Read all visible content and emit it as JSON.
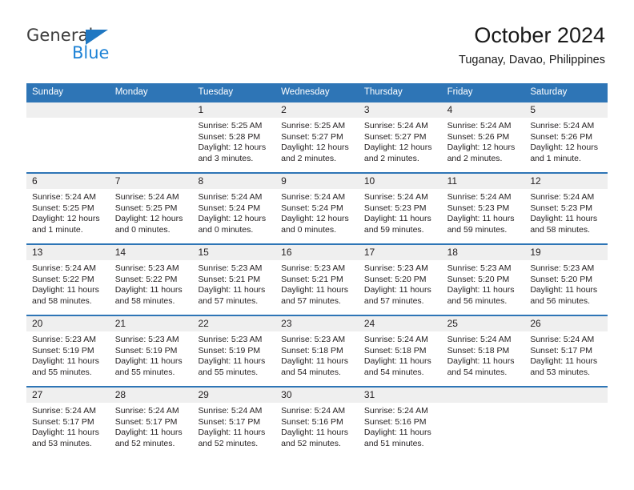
{
  "brand": {
    "name_part1": "General",
    "name_part2": "Blue",
    "triangle_color": "#1f77c2",
    "blue_color": "#1f83d6"
  },
  "header": {
    "title": "October 2024",
    "subtitle": "Tuganay, Davao, Philippines"
  },
  "theme": {
    "header_blue": "#2e75b6",
    "day_band_gray": "#efefef",
    "text": "#231f20"
  },
  "weekday_headers": [
    "Sunday",
    "Monday",
    "Tuesday",
    "Wednesday",
    "Thursday",
    "Friday",
    "Saturday"
  ],
  "weeks": [
    [
      {
        "day": "",
        "sunrise": "",
        "sunset": "",
        "daylight1": "",
        "daylight2": ""
      },
      {
        "day": "",
        "sunrise": "",
        "sunset": "",
        "daylight1": "",
        "daylight2": ""
      },
      {
        "day": "1",
        "sunrise": "Sunrise: 5:25 AM",
        "sunset": "Sunset: 5:28 PM",
        "daylight1": "Daylight: 12 hours",
        "daylight2": "and 3 minutes."
      },
      {
        "day": "2",
        "sunrise": "Sunrise: 5:25 AM",
        "sunset": "Sunset: 5:27 PM",
        "daylight1": "Daylight: 12 hours",
        "daylight2": "and 2 minutes."
      },
      {
        "day": "3",
        "sunrise": "Sunrise: 5:24 AM",
        "sunset": "Sunset: 5:27 PM",
        "daylight1": "Daylight: 12 hours",
        "daylight2": "and 2 minutes."
      },
      {
        "day": "4",
        "sunrise": "Sunrise: 5:24 AM",
        "sunset": "Sunset: 5:26 PM",
        "daylight1": "Daylight: 12 hours",
        "daylight2": "and 2 minutes."
      },
      {
        "day": "5",
        "sunrise": "Sunrise: 5:24 AM",
        "sunset": "Sunset: 5:26 PM",
        "daylight1": "Daylight: 12 hours",
        "daylight2": "and 1 minute."
      }
    ],
    [
      {
        "day": "6",
        "sunrise": "Sunrise: 5:24 AM",
        "sunset": "Sunset: 5:25 PM",
        "daylight1": "Daylight: 12 hours",
        "daylight2": "and 1 minute."
      },
      {
        "day": "7",
        "sunrise": "Sunrise: 5:24 AM",
        "sunset": "Sunset: 5:25 PM",
        "daylight1": "Daylight: 12 hours",
        "daylight2": "and 0 minutes."
      },
      {
        "day": "8",
        "sunrise": "Sunrise: 5:24 AM",
        "sunset": "Sunset: 5:24 PM",
        "daylight1": "Daylight: 12 hours",
        "daylight2": "and 0 minutes."
      },
      {
        "day": "9",
        "sunrise": "Sunrise: 5:24 AM",
        "sunset": "Sunset: 5:24 PM",
        "daylight1": "Daylight: 12 hours",
        "daylight2": "and 0 minutes."
      },
      {
        "day": "10",
        "sunrise": "Sunrise: 5:24 AM",
        "sunset": "Sunset: 5:23 PM",
        "daylight1": "Daylight: 11 hours",
        "daylight2": "and 59 minutes."
      },
      {
        "day": "11",
        "sunrise": "Sunrise: 5:24 AM",
        "sunset": "Sunset: 5:23 PM",
        "daylight1": "Daylight: 11 hours",
        "daylight2": "and 59 minutes."
      },
      {
        "day": "12",
        "sunrise": "Sunrise: 5:24 AM",
        "sunset": "Sunset: 5:23 PM",
        "daylight1": "Daylight: 11 hours",
        "daylight2": "and 58 minutes."
      }
    ],
    [
      {
        "day": "13",
        "sunrise": "Sunrise: 5:24 AM",
        "sunset": "Sunset: 5:22 PM",
        "daylight1": "Daylight: 11 hours",
        "daylight2": "and 58 minutes."
      },
      {
        "day": "14",
        "sunrise": "Sunrise: 5:23 AM",
        "sunset": "Sunset: 5:22 PM",
        "daylight1": "Daylight: 11 hours",
        "daylight2": "and 58 minutes."
      },
      {
        "day": "15",
        "sunrise": "Sunrise: 5:23 AM",
        "sunset": "Sunset: 5:21 PM",
        "daylight1": "Daylight: 11 hours",
        "daylight2": "and 57 minutes."
      },
      {
        "day": "16",
        "sunrise": "Sunrise: 5:23 AM",
        "sunset": "Sunset: 5:21 PM",
        "daylight1": "Daylight: 11 hours",
        "daylight2": "and 57 minutes."
      },
      {
        "day": "17",
        "sunrise": "Sunrise: 5:23 AM",
        "sunset": "Sunset: 5:20 PM",
        "daylight1": "Daylight: 11 hours",
        "daylight2": "and 57 minutes."
      },
      {
        "day": "18",
        "sunrise": "Sunrise: 5:23 AM",
        "sunset": "Sunset: 5:20 PM",
        "daylight1": "Daylight: 11 hours",
        "daylight2": "and 56 minutes."
      },
      {
        "day": "19",
        "sunrise": "Sunrise: 5:23 AM",
        "sunset": "Sunset: 5:20 PM",
        "daylight1": "Daylight: 11 hours",
        "daylight2": "and 56 minutes."
      }
    ],
    [
      {
        "day": "20",
        "sunrise": "Sunrise: 5:23 AM",
        "sunset": "Sunset: 5:19 PM",
        "daylight1": "Daylight: 11 hours",
        "daylight2": "and 55 minutes."
      },
      {
        "day": "21",
        "sunrise": "Sunrise: 5:23 AM",
        "sunset": "Sunset: 5:19 PM",
        "daylight1": "Daylight: 11 hours",
        "daylight2": "and 55 minutes."
      },
      {
        "day": "22",
        "sunrise": "Sunrise: 5:23 AM",
        "sunset": "Sunset: 5:19 PM",
        "daylight1": "Daylight: 11 hours",
        "daylight2": "and 55 minutes."
      },
      {
        "day": "23",
        "sunrise": "Sunrise: 5:23 AM",
        "sunset": "Sunset: 5:18 PM",
        "daylight1": "Daylight: 11 hours",
        "daylight2": "and 54 minutes."
      },
      {
        "day": "24",
        "sunrise": "Sunrise: 5:24 AM",
        "sunset": "Sunset: 5:18 PM",
        "daylight1": "Daylight: 11 hours",
        "daylight2": "and 54 minutes."
      },
      {
        "day": "25",
        "sunrise": "Sunrise: 5:24 AM",
        "sunset": "Sunset: 5:18 PM",
        "daylight1": "Daylight: 11 hours",
        "daylight2": "and 54 minutes."
      },
      {
        "day": "26",
        "sunrise": "Sunrise: 5:24 AM",
        "sunset": "Sunset: 5:17 PM",
        "daylight1": "Daylight: 11 hours",
        "daylight2": "and 53 minutes."
      }
    ],
    [
      {
        "day": "27",
        "sunrise": "Sunrise: 5:24 AM",
        "sunset": "Sunset: 5:17 PM",
        "daylight1": "Daylight: 11 hours",
        "daylight2": "and 53 minutes."
      },
      {
        "day": "28",
        "sunrise": "Sunrise: 5:24 AM",
        "sunset": "Sunset: 5:17 PM",
        "daylight1": "Daylight: 11 hours",
        "daylight2": "and 52 minutes."
      },
      {
        "day": "29",
        "sunrise": "Sunrise: 5:24 AM",
        "sunset": "Sunset: 5:17 PM",
        "daylight1": "Daylight: 11 hours",
        "daylight2": "and 52 minutes."
      },
      {
        "day": "30",
        "sunrise": "Sunrise: 5:24 AM",
        "sunset": "Sunset: 5:16 PM",
        "daylight1": "Daylight: 11 hours",
        "daylight2": "and 52 minutes."
      },
      {
        "day": "31",
        "sunrise": "Sunrise: 5:24 AM",
        "sunset": "Sunset: 5:16 PM",
        "daylight1": "Daylight: 11 hours",
        "daylight2": "and 51 minutes."
      },
      {
        "day": "",
        "sunrise": "",
        "sunset": "",
        "daylight1": "",
        "daylight2": ""
      },
      {
        "day": "",
        "sunrise": "",
        "sunset": "",
        "daylight1": "",
        "daylight2": ""
      }
    ]
  ]
}
